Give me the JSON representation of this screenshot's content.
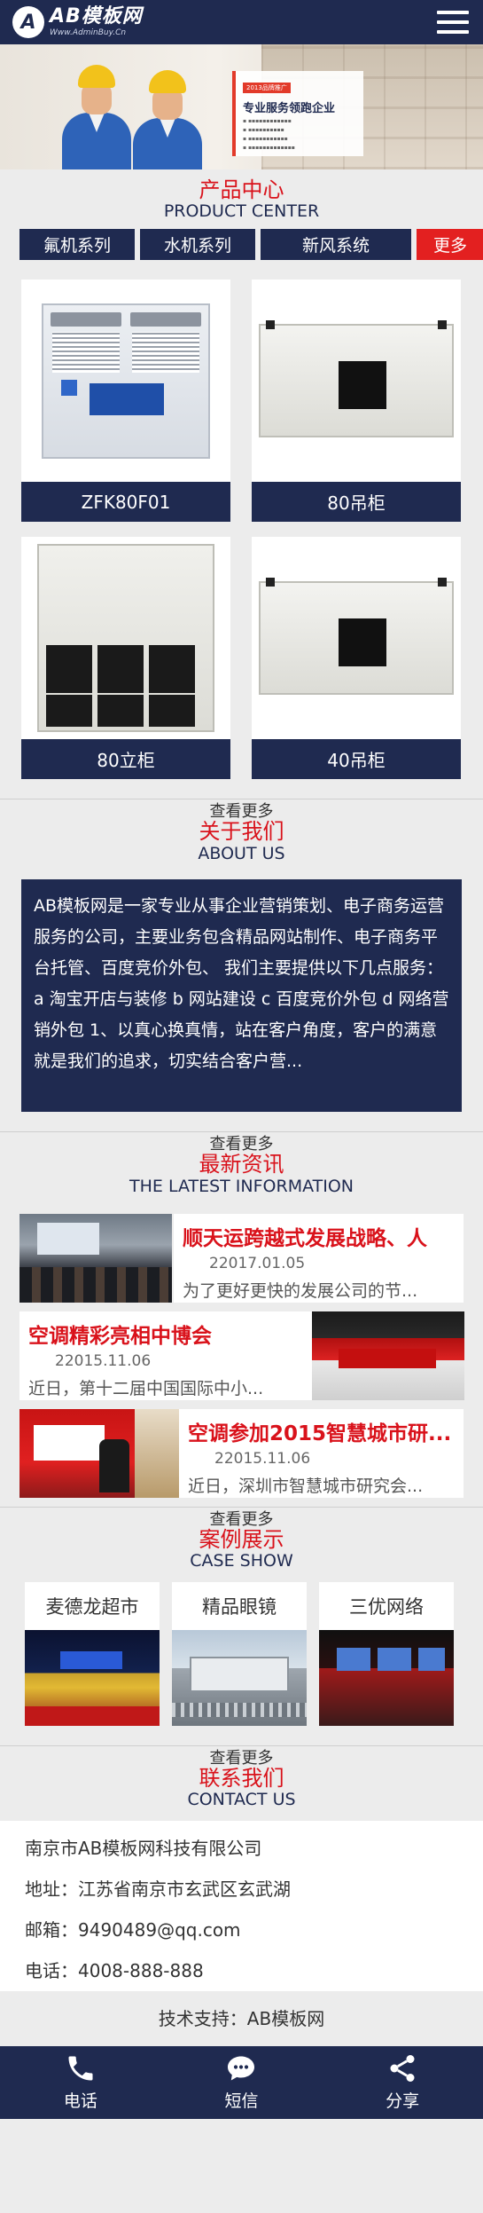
{
  "header": {
    "logo_mark": "A",
    "logo_title": "AB模板网",
    "logo_sub": "Www.AdminBuy.Cn"
  },
  "banner": {
    "tag": "2013品牌推广",
    "headline": "专业服务领跑企业"
  },
  "products": {
    "title": "产品中心",
    "subtitle": "PRODUCT CENTER",
    "tabs": [
      "氟机系列",
      "水机系列",
      "新风系统"
    ],
    "more_tab": "更多",
    "items": [
      {
        "name": "ZFK80F01"
      },
      {
        "name": "80吊柜"
      },
      {
        "name": "80立柜"
      },
      {
        "name": "40吊柜"
      }
    ],
    "more_link": "查看更多"
  },
  "about": {
    "title": "关于我们",
    "subtitle": "ABOUT US",
    "text": "AB模板网是一家专业从事企业营销策划、电子商务运营服务的公司，主要业务包含精品网站制作、电子商务平台托管、百度竞价外包、 我们主要提供以下几点服务： a 淘宝开店与装修 b 网站建设 c 百度竞价外包 d 网络营销外包 1、以真心换真情，站在客户角度，客户的满意就是我们的追求，切实结合客户营...",
    "more_link": "查看更多"
  },
  "news": {
    "title": "最新资讯",
    "subtitle": "THE LATEST INFORMATION",
    "items": [
      {
        "title": "顺天运跨越式发展战略、人",
        "date": "22017.01.05",
        "desc": "为了更好更快的发展公司的节..."
      },
      {
        "title": "空调精彩亮相中博会",
        "date": "22015.11.06",
        "desc": "近日，第十二届中国国际中小..."
      },
      {
        "title": "空调参加2015智慧城市研...",
        "date": "22015.11.06",
        "desc": "近日，深圳市智慧城市研究会..."
      }
    ],
    "more_link": "查看更多"
  },
  "cases": {
    "title": "案例展示",
    "subtitle": "CASE SHOW",
    "items": [
      {
        "name": "麦德龙超市"
      },
      {
        "name": "精品眼镜"
      },
      {
        "name": "三优网络"
      }
    ],
    "more_link": "查看更多"
  },
  "contact": {
    "title": "联系我们",
    "subtitle": "CONTACT US",
    "company": "南京市AB模板网科技有限公司",
    "address": "地址：江苏省南京市玄武区玄武湖",
    "email": "邮箱：9490489@qq.com",
    "phone": "电话：4008-888-888"
  },
  "footer": {
    "support": "技术支持：AB模板网"
  },
  "bottom_bar": {
    "phone": "电话",
    "sms": "短信",
    "share": "分享"
  },
  "colors": {
    "navy": "#1f2a50",
    "red": "#d9121b",
    "more_red": "#e32020"
  }
}
